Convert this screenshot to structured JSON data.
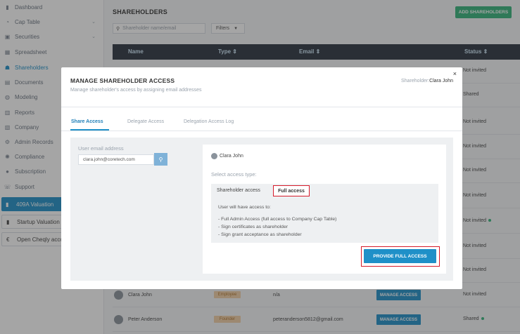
{
  "sidebar": {
    "items": [
      {
        "label": "Dashboard",
        "icon": "dashboard-icon"
      },
      {
        "label": "Cap Table",
        "icon": "cap-table-icon"
      },
      {
        "label": "Securities",
        "icon": "securities-icon"
      },
      {
        "label": "Spreadsheet",
        "icon": "spreadsheet-icon"
      },
      {
        "label": "Shareholders",
        "icon": "shareholders-icon"
      },
      {
        "label": "Documents",
        "icon": "documents-icon"
      },
      {
        "label": "Modeling",
        "icon": "modeling-icon"
      },
      {
        "label": "Reports",
        "icon": "reports-icon"
      },
      {
        "label": "Company",
        "icon": "company-icon"
      },
      {
        "label": "Admin Records",
        "icon": "admin-records-icon"
      },
      {
        "label": "Compliance",
        "icon": "compliance-icon"
      },
      {
        "label": "Subscription",
        "icon": "subscription-icon"
      },
      {
        "label": "Support",
        "icon": "support-icon"
      }
    ],
    "valuation_label": "409A Valuation",
    "startup_label": "Startup Valuation",
    "cheqly_label": "Open Cheqly acco"
  },
  "header": {
    "title": "SHAREHOLDERS",
    "add_button": "ADD SHAREHOLDERS",
    "search_placeholder": "Shareholder name/email",
    "filters_label": "Filters"
  },
  "table": {
    "columns": [
      "Name",
      "Type ⇕",
      "Email ⇕",
      "Status ⇕"
    ],
    "statuses": [
      "Not invited",
      "Shared",
      "Not invited",
      "Not invited",
      "Not invited",
      "Not invited",
      "Not invited",
      "Not invited",
      "Not invited"
    ],
    "visible_rows": [
      {
        "name": "Clara John",
        "type": "Employee",
        "email": "n/a",
        "action": "MANAGE ACCESS",
        "status": "Not invited",
        "dot": false
      },
      {
        "name": "Peter Anderson",
        "type": "Founder",
        "email": "peteranderson5812@gmail.com",
        "action": "MANAGE ACCESS",
        "status": "Shared",
        "dot": true
      }
    ]
  },
  "modal": {
    "title": "MANAGE SHAREHOLDER ACCESS",
    "subtitle": "Manage shareholder's access by assigning email addresses",
    "holder_prefix": "Shareholder:",
    "holder_name": "Clara John",
    "close": "×",
    "tabs": [
      "Share Access",
      "Delegate Access",
      "Delegation Access Log"
    ],
    "email_label": "User email address",
    "email_value": "clara.john@coretech.com",
    "card_user": "Clara John",
    "select_label": "Select access type:",
    "options": [
      "Shareholder access",
      "Full access"
    ],
    "access_heading": "User will have access to:",
    "access_items": [
      "Full Admin Access (full access to Company Cap Table)",
      "Sign certificates as shareholder",
      "Sign grant acceptance as shareholder"
    ],
    "provide_button": "PROVIDE FULL ACCESS"
  }
}
